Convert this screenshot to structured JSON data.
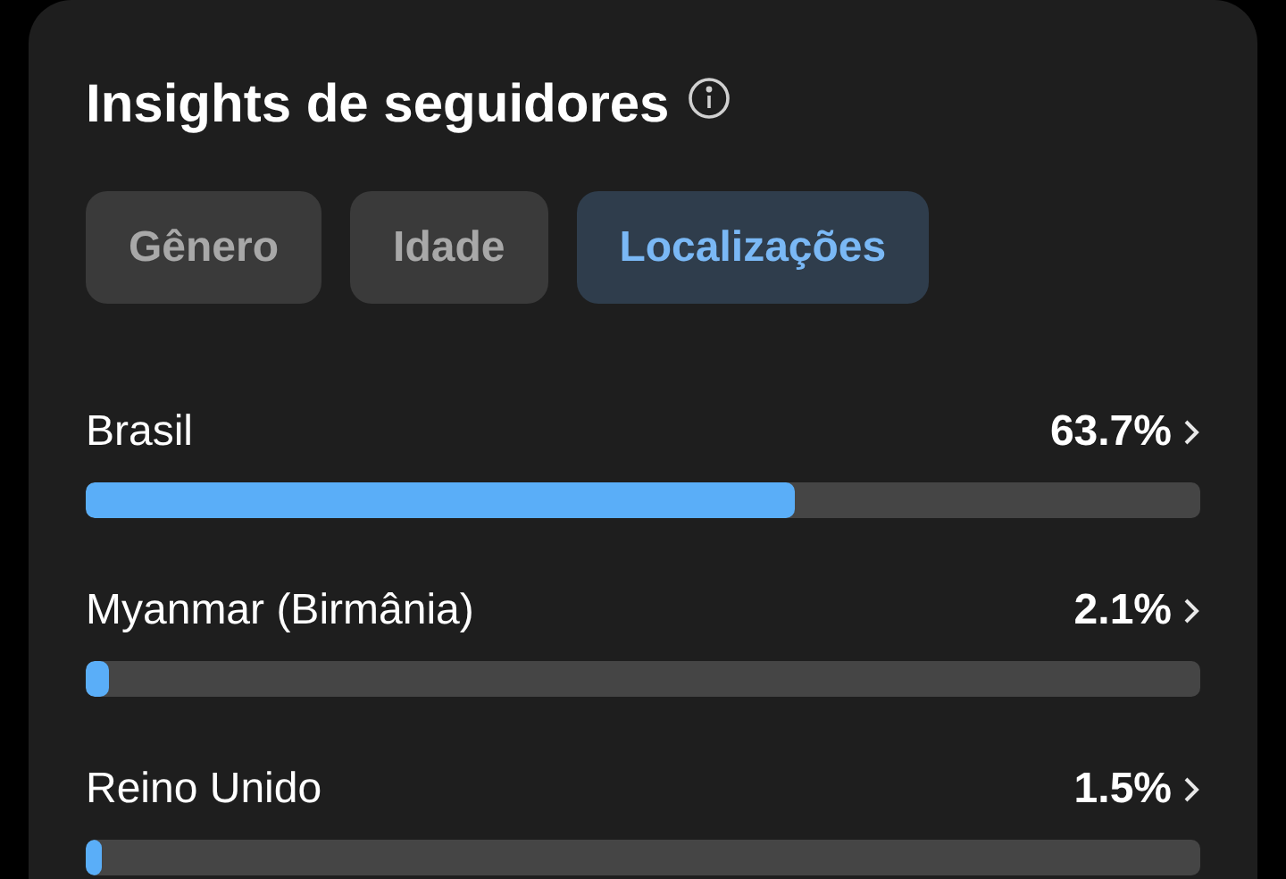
{
  "title": "Insights de seguidores",
  "tabs": [
    {
      "label": "Gênero",
      "selected": false
    },
    {
      "label": "Idade",
      "selected": false
    },
    {
      "label": "Localizações",
      "selected": true
    }
  ],
  "locations": [
    {
      "name": "Brasil",
      "reading": "63.7%",
      "level": 0.637
    },
    {
      "name": "Myanmar (Birmânia)",
      "reading": "2.1%",
      "level": 0.021
    },
    {
      "name": "Reino Unido",
      "reading": "1.5%",
      "level": 0.015
    }
  ]
}
